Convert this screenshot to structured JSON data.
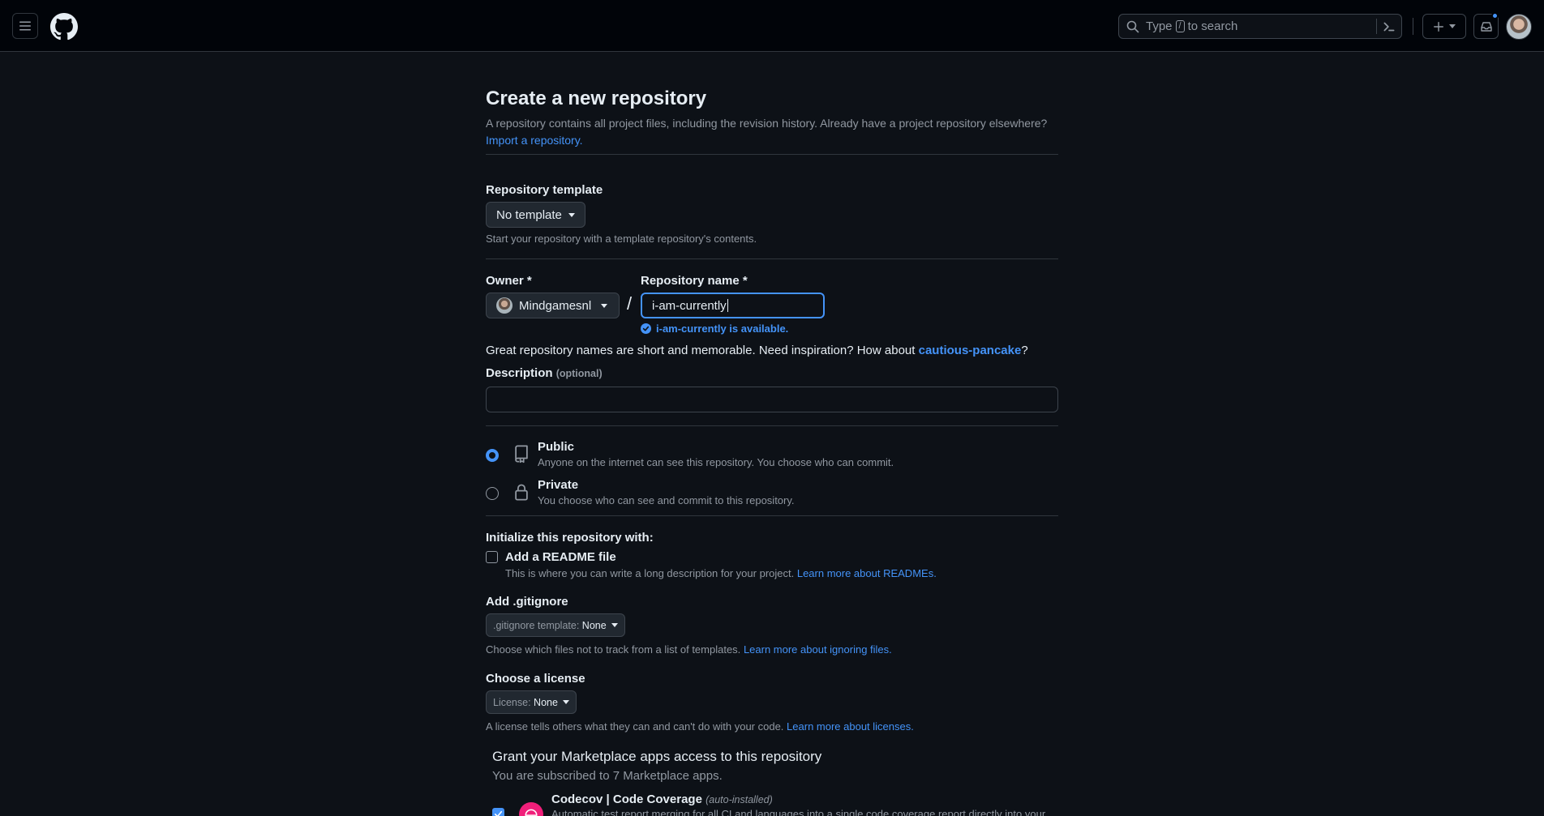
{
  "header": {
    "search_prefix": "Type",
    "search_key": "/",
    "search_suffix": "to search"
  },
  "page": {
    "title": "Create a new repository",
    "subtitle": "A repository contains all project files, including the revision history. Already have a project repository elsewhere?",
    "import_link": "Import a repository."
  },
  "template": {
    "label": "Repository template",
    "value": "No template",
    "note": "Start your repository with a template repository's contents."
  },
  "owner": {
    "label": "Owner *",
    "value": "Mindgamesnl"
  },
  "repo": {
    "label": "Repository name *",
    "value": "i-am-currently",
    "availability": "i-am-currently is available.",
    "hint_prefix": "Great repository names are short and memorable. Need inspiration? How about",
    "suggestion": "cautious-pancake",
    "hint_suffix": "?"
  },
  "description": {
    "label": "Description",
    "optional": "(optional)",
    "value": ""
  },
  "visibility": {
    "selected": "public",
    "public_title": "Public",
    "public_desc": "Anyone on the internet can see this repository. You choose who can commit.",
    "private_title": "Private",
    "private_desc": "You choose who can see and commit to this repository."
  },
  "init": {
    "label": "Initialize this repository with:",
    "readme_label": "Add a README file",
    "readme_checked": false,
    "readme_desc": "This is where you can write a long description for your project.",
    "readme_link": "Learn more about READMEs."
  },
  "gitignore": {
    "label": "Add .gitignore",
    "prefix": ".gitignore template:",
    "value": "None",
    "note": "Choose which files not to track from a list of templates.",
    "link": "Learn more about ignoring files."
  },
  "license": {
    "label": "Choose a license",
    "prefix": "License:",
    "value": "None",
    "note": "A license tells others what they can and can't do with your code.",
    "link": "Learn more about licenses."
  },
  "marketplace": {
    "title": "Grant your Marketplace apps access to this repository",
    "subtitle": "You are subscribed to 7 Marketplace apps.",
    "apps": [
      {
        "name": "Codecov | Code Coverage",
        "tag": "(auto-installed)",
        "desc": "Automatic test report merging for all CI and languages into a single code coverage report directly into your",
        "checked": true
      }
    ]
  },
  "colors": {
    "background": "#0d1117",
    "header": "#010409",
    "accent": "#4493f8",
    "border": "#30363d",
    "muted_text": "#9198a1",
    "codecov": "#f01f7a"
  }
}
